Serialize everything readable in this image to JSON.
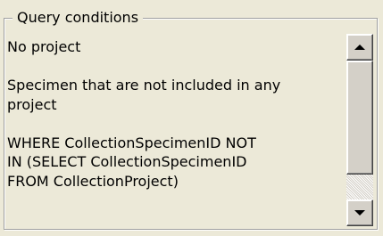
{
  "group": {
    "title": "Query conditions"
  },
  "text": {
    "lines": [
      "No project",
      "",
      "Specimen that are not included in any",
      "project",
      "",
      "WHERE CollectionSpecimenID NOT",
      "IN (SELECT CollectionSpecimenID",
      "FROM CollectionProject)"
    ]
  },
  "scrollbar": {
    "up_icon": "arrow-up-icon",
    "down_icon": "arrow-down-icon"
  },
  "colors": {
    "background": "#ece9d8",
    "text": "#000000"
  }
}
